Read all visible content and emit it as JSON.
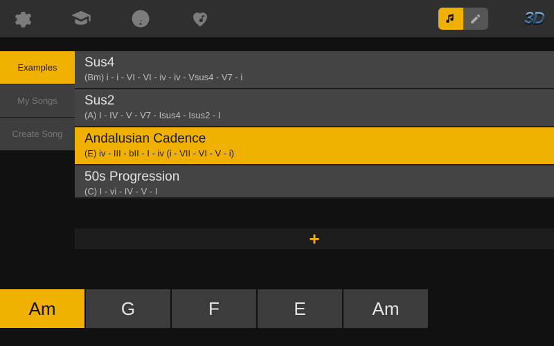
{
  "colors": {
    "accent": "#f0b000"
  },
  "sidebar": {
    "tabs": [
      {
        "label": "Examples",
        "active": true
      },
      {
        "label": "My Songs",
        "active": false
      },
      {
        "label": "Create Song",
        "active": false
      }
    ]
  },
  "list": {
    "items": [
      {
        "title": "Sus4",
        "sub": "(Bm) i - i - VI - VI - iv - iv - Vsus4 - V7 - i",
        "selected": false
      },
      {
        "title": "Sus2",
        "sub": "(A) I - IV - V - V7 - Isus4 - Isus2 - I",
        "selected": false
      },
      {
        "title": "Andalusian Cadence",
        "sub": "(E)  iv - III - bII - I - iv (i - VII - VI - V - i)",
        "selected": true
      },
      {
        "title": "50s Progression",
        "sub": "(C)  I - vi - IV - V - I",
        "selected": false
      }
    ],
    "add_label": "+"
  },
  "chords": [
    {
      "label": "Am",
      "active": true
    },
    {
      "label": "G",
      "active": false
    },
    {
      "label": "F",
      "active": false
    },
    {
      "label": "E",
      "active": false
    },
    {
      "label": "Am",
      "active": false
    }
  ],
  "toolbar": {
    "threeD": "3D",
    "mode": {
      "music_active": true
    }
  }
}
